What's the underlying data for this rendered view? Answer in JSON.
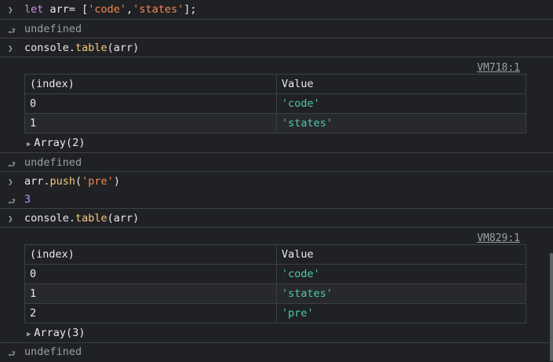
{
  "entries": {
    "cmd1": {
      "kw": "let",
      "a": " arr= [",
      "s1": "'code'",
      "c": ",",
      "s2": "'states'",
      "e": "];"
    },
    "undef1": "undefined",
    "cmd2": {
      "a": "console.",
      "fn": "table",
      "b": "(arr)"
    },
    "table1": {
      "source": "VM718:1",
      "headers": [
        "(index)",
        "Value"
      ],
      "rows": [
        [
          "0",
          "'code'"
        ],
        [
          "1",
          "'states'"
        ]
      ],
      "array_label": "Array(2)"
    },
    "undef2": "undefined",
    "cmd3": {
      "a": "arr.",
      "fn": "push",
      "b": "(",
      "s": "'pre'",
      "c": ")"
    },
    "result3": "3",
    "cmd4": {
      "a": "console.",
      "fn": "table",
      "b": "(arr)"
    },
    "table2": {
      "source": "VM829:1",
      "headers": [
        "(index)",
        "Value"
      ],
      "rows": [
        [
          "0",
          "'code'"
        ],
        [
          "1",
          "'states'"
        ],
        [
          "2",
          "'pre'"
        ]
      ],
      "array_label": "Array(3)"
    },
    "undef3": "undefined"
  },
  "icons": {
    "input": "chevron-right-icon",
    "output": "return-arrow-icon",
    "expand": "triangle-right-icon"
  }
}
